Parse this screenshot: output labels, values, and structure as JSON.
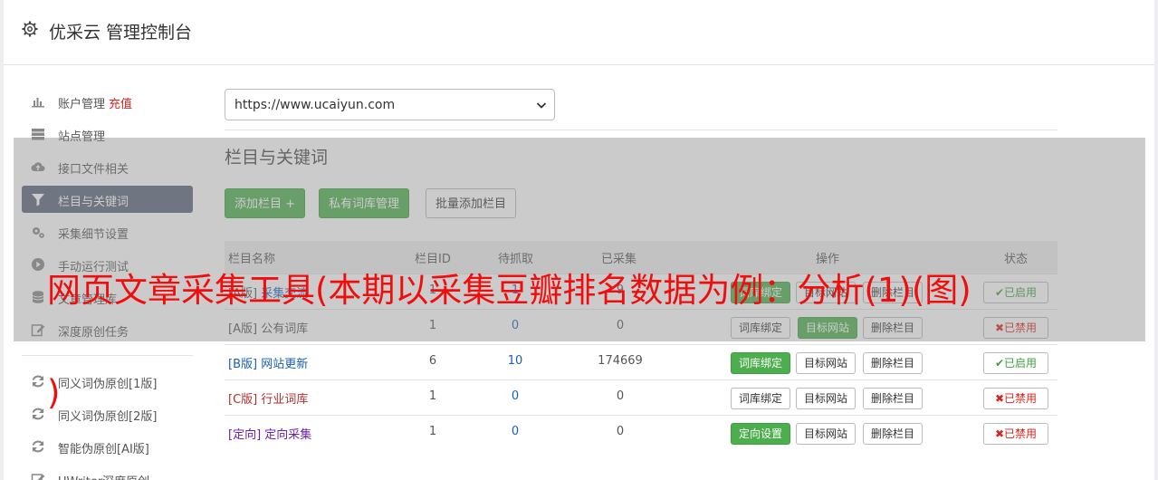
{
  "header": {
    "title": "优采云 管理控制台",
    "icon": "gear-icon"
  },
  "sidebar": {
    "items": [
      {
        "label": "账户管理",
        "extra": "充值",
        "icon": "bar-chart-icon"
      },
      {
        "label": "站点管理",
        "icon": "server-icon"
      },
      {
        "label": "接口文件相关",
        "icon": "cloud-upload-icon"
      },
      {
        "label": "栏目与关键词",
        "icon": "filter-icon",
        "active": true
      },
      {
        "label": "采集细节设置",
        "icon": "gears-icon"
      },
      {
        "label": "手动运行测试",
        "icon": "play-circle-icon"
      },
      {
        "label": "文章管理库",
        "icon": "database-icon"
      },
      {
        "label": "深度原创任务",
        "icon": "edit-icon"
      }
    ],
    "tools": [
      {
        "label": "同义词伪原创[1版]",
        "icon": "refresh-icon"
      },
      {
        "label": "同义词伪原创[2版]",
        "icon": "refresh-icon"
      },
      {
        "label": "智能伪原创[AI版]",
        "icon": "refresh-icon"
      },
      {
        "label": "UWriter深度原创",
        "icon": "edit-icon"
      }
    ]
  },
  "main": {
    "site_select": "https://www.ucaiyun.com",
    "section_title": "栏目与关键词",
    "buttons": {
      "add": "添加栏目 +",
      "private_lib": "私有词库管理",
      "batch_add": "批量添加栏目"
    },
    "table": {
      "headers": [
        "栏目名称",
        "栏目ID",
        "待抓取",
        "已采集",
        "操作",
        "状态"
      ],
      "rows": [
        {
          "tag": "[A版]",
          "name": "采集交流",
          "id": "1",
          "pending": "1",
          "collected": "9",
          "op1": "词库绑定",
          "op2": "目标网站",
          "op3": "删除栏目",
          "status": "已启用"
        },
        {
          "tag": "[A版]",
          "name": "公有词库",
          "id": "1",
          "pending": "0",
          "collected": "0",
          "op1": "词库绑定",
          "op2": "目标网站",
          "op3": "删除栏目",
          "status": "已禁用"
        },
        {
          "tag": "[B版]",
          "name": "网站更新",
          "id": "6",
          "pending": "10",
          "collected": "174669",
          "op1": "词库绑定",
          "op2": "目标网站",
          "op3": "删除栏目",
          "status": "已启用"
        },
        {
          "tag": "[C版]",
          "name": "行业词库",
          "id": "1",
          "pending": "0",
          "collected": "0",
          "op1": "词库绑定",
          "op2": "目标网站",
          "op3": "删除栏目",
          "status": "已禁用"
        },
        {
          "tag": "[定向]",
          "name": "定向采集",
          "id": "1",
          "pending": "0",
          "collected": "0",
          "op1": "定向设置",
          "op2": "目标网站",
          "op3": "删除栏目",
          "status": "已禁用"
        }
      ]
    }
  },
  "overlay": {
    "headline": "网页文章采集工具(本期以采集豆瓣排名数据为例：分析(1)(图)",
    "trailing": ")"
  },
  "colors": {
    "accent_green": "#4cae4c",
    "red": "#d9231b",
    "blue": "#1a5fb4",
    "active_nav": "#5a6478",
    "overlay_text": "#f20d0d"
  }
}
